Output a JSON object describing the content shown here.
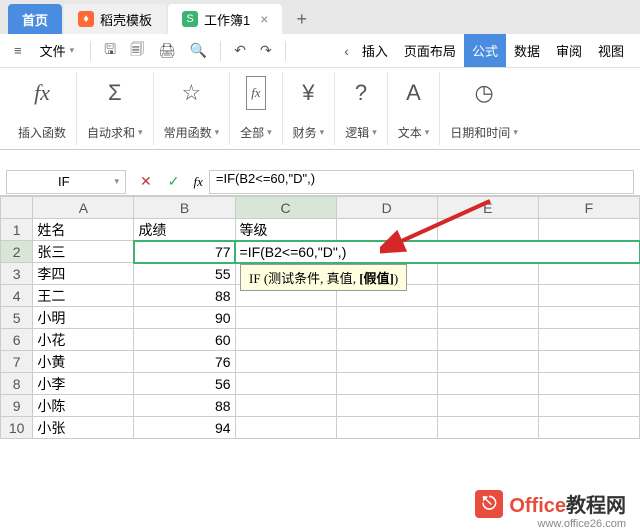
{
  "tabs": {
    "home": "首页",
    "doc1": "稻壳模板",
    "doc2": "工作簿1"
  },
  "file_menu": "文件",
  "ribbon_tabs": {
    "insert": "插入",
    "layout": "页面布局",
    "formula": "公式",
    "data": "数据",
    "review": "审阅",
    "view": "视图"
  },
  "ribbon_groups": {
    "insert_fn": "插入函数",
    "autosum": "自动求和",
    "common": "常用函数",
    "all": "全部",
    "finance": "财务",
    "logic": "逻辑",
    "text": "文本",
    "datetime": "日期和时间"
  },
  "name_box": "IF",
  "formula_bar": "=IF(B2<=60,\"D\",)",
  "cell_editing": "=IF(B2<=60,\"D\",)",
  "columns": [
    "A",
    "B",
    "C",
    "D",
    "E",
    "F"
  ],
  "rows": [
    {
      "n": "1",
      "a": "姓名",
      "b": "成绩",
      "c": "等级"
    },
    {
      "n": "2",
      "a": "张三",
      "b": "77"
    },
    {
      "n": "3",
      "a": "李四",
      "b": "55"
    },
    {
      "n": "4",
      "a": "王二",
      "b": "88"
    },
    {
      "n": "5",
      "a": "小明",
      "b": "90"
    },
    {
      "n": "6",
      "a": "小花",
      "b": "60"
    },
    {
      "n": "7",
      "a": "小黄",
      "b": "76"
    },
    {
      "n": "8",
      "a": "小李",
      "b": "56"
    },
    {
      "n": "9",
      "a": "小陈",
      "b": "88"
    },
    {
      "n": "10",
      "a": "小张",
      "b": "94"
    }
  ],
  "tooltip": {
    "fn": "IF",
    "open": " (",
    "arg1": "测试条件",
    "sep1": ", ",
    "arg2": "真值",
    "sep2": ", ",
    "arg3": "[假值]",
    "close": ")"
  },
  "watermark": {
    "t1": "Office",
    "t2": "教程网",
    "url": "www.office26.com"
  }
}
